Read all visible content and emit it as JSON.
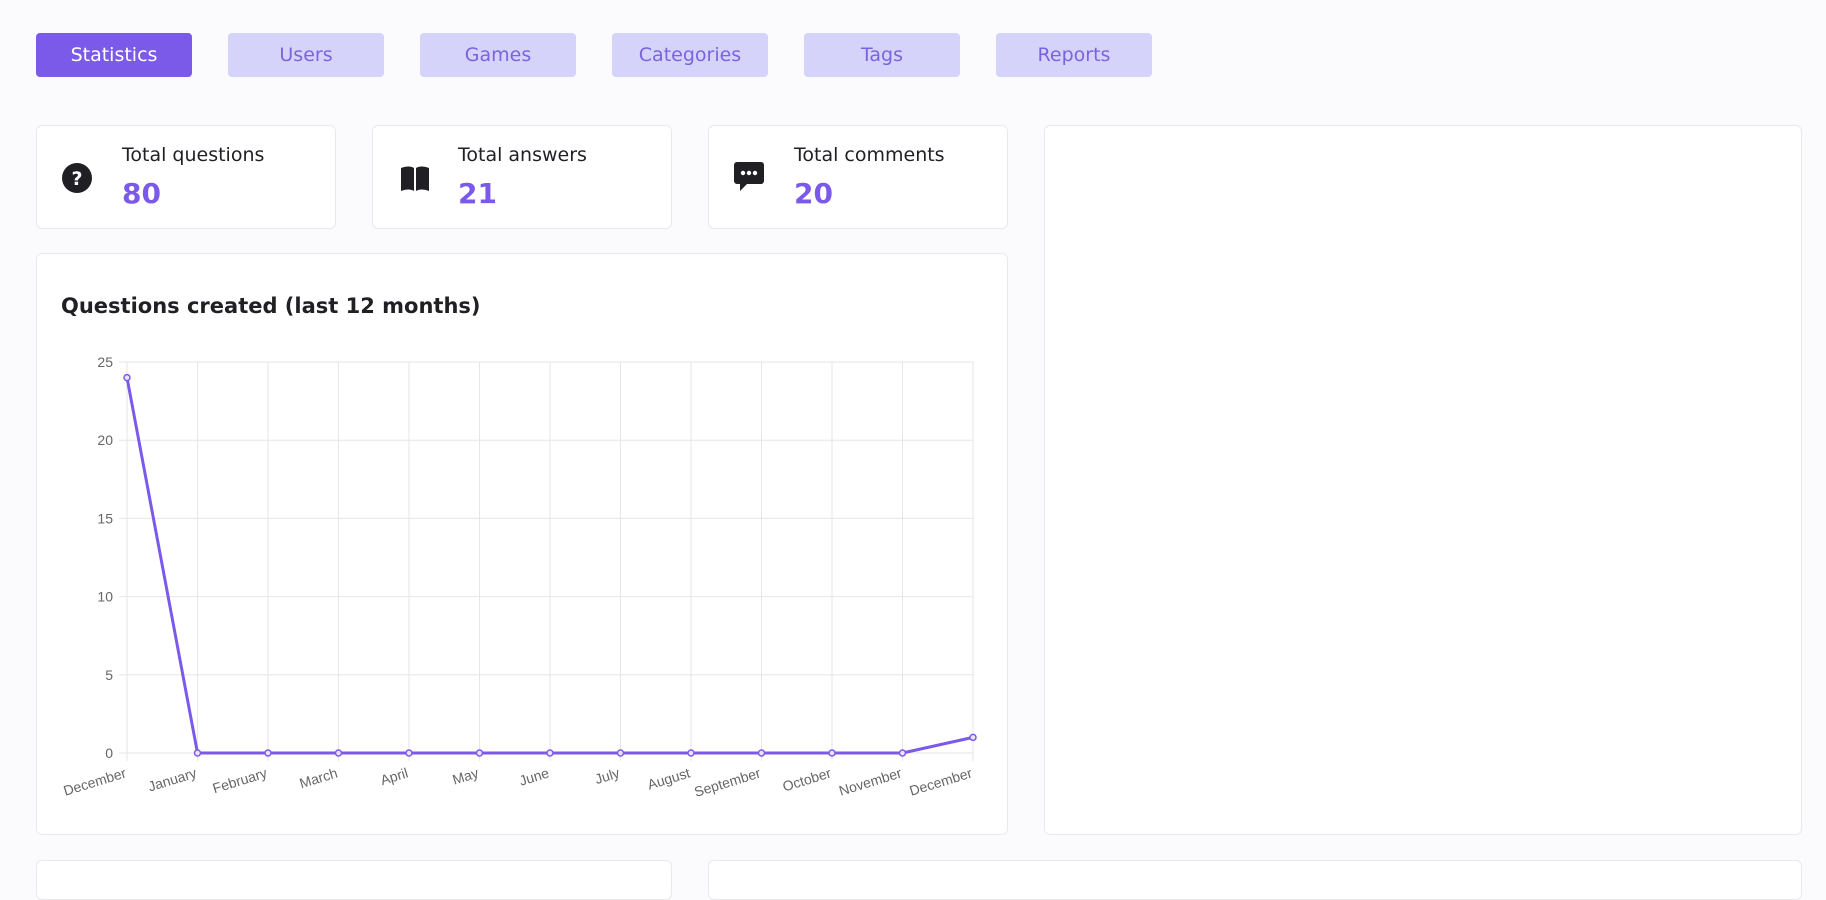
{
  "nav": {
    "items": [
      {
        "label": "Statistics",
        "active": true
      },
      {
        "label": "Users",
        "active": false
      },
      {
        "label": "Games",
        "active": false
      },
      {
        "label": "Categories",
        "active": false
      },
      {
        "label": "Tags",
        "active": false
      },
      {
        "label": "Reports",
        "active": false
      }
    ]
  },
  "stats": [
    {
      "label": "Total questions",
      "value": "80",
      "icon": "question-circle-icon"
    },
    {
      "label": "Total answers",
      "value": "21",
      "icon": "book-open-icon"
    },
    {
      "label": "Total comments",
      "value": "20",
      "icon": "comment-dots-icon"
    }
  ],
  "colors": {
    "accent": "#7b5ae9",
    "nav_inactive_bg": "#d6d3fb",
    "nav_inactive_text": "#7a63dc",
    "grid": "#e6e6e6",
    "tick_text": "#666666"
  },
  "chart_data": {
    "type": "line",
    "title": "Questions created (last 12 months)",
    "categories": [
      "December",
      "January",
      "February",
      "March",
      "April",
      "May",
      "June",
      "July",
      "August",
      "September",
      "October",
      "November",
      "December"
    ],
    "series": [
      {
        "values": [
          24,
          0,
          0,
          0,
          0,
          0,
          0,
          0,
          0,
          0,
          0,
          0,
          1
        ]
      }
    ],
    "xlabel": "",
    "ylabel": "",
    "ylim": [
      0,
      25
    ],
    "yticks": [
      0,
      5,
      10,
      15,
      20,
      25
    ],
    "grid": true,
    "legend": "none"
  }
}
